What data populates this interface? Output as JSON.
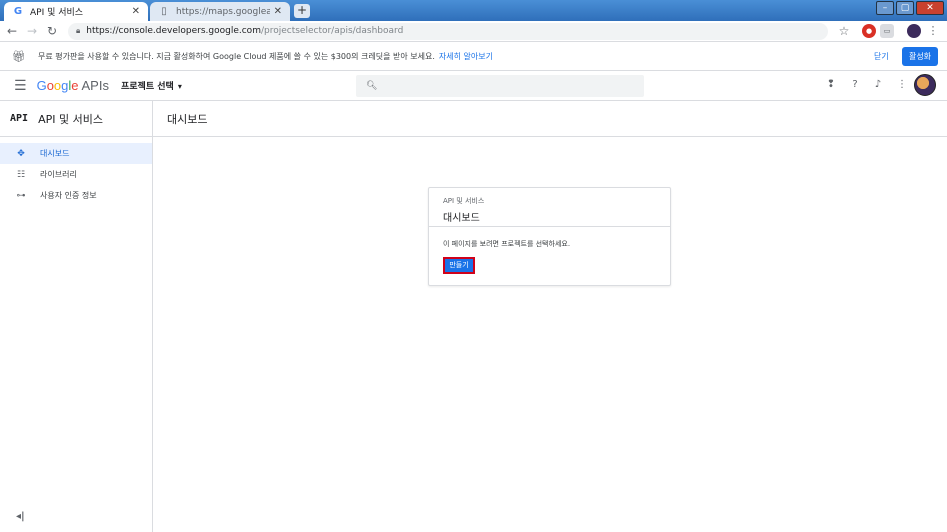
{
  "browser": {
    "tabs": [
      {
        "title": "API 및 서비스",
        "favicon": "G",
        "active": true
      },
      {
        "title": "https://maps.googleapis.com/m",
        "active": false
      }
    ],
    "new_tab_symbol": "+",
    "window_controls": [
      "–",
      "▢",
      "✕"
    ],
    "url_host": "https://console.developers.google.com",
    "url_path": "/projectselector/apis/dashboard"
  },
  "promo": {
    "text": "무료 평가판을 사용할 수 있습니다. 지금 활성화하여 Google Cloud 제품에 쓸 수 있는 $300의 크레딧을 받아 보세요.",
    "link": "자세히 알아보기",
    "dismiss": "닫기",
    "activate": "활성화"
  },
  "header": {
    "brand_letters": [
      "G",
      "o",
      "o",
      "g",
      "l",
      "e"
    ],
    "brand_suffix": "APIs",
    "project_selector": "프로젝트 선택",
    "caret": "▾"
  },
  "sidebar": {
    "badge": "API",
    "title": "API 및 서비스",
    "items": [
      {
        "label": "대시보드",
        "icon": "dashboard-icon",
        "active": true
      },
      {
        "label": "라이브러리",
        "icon": "library-icon",
        "active": false
      },
      {
        "label": "사용자 인증 정보",
        "icon": "key-icon",
        "active": false
      }
    ],
    "collapse_symbol": "◂|"
  },
  "main": {
    "title": "대시보드",
    "card": {
      "subtitle": "API 및 서비스",
      "title": "대시보드",
      "message": "이 페이지를 보려면 프로젝트를 선택하세요.",
      "button": "만들기"
    }
  },
  "colors": {
    "accent": "#1a73e8",
    "highlight_border": "#d0021b",
    "sidebar_active_bg": "#e8f0fe"
  }
}
